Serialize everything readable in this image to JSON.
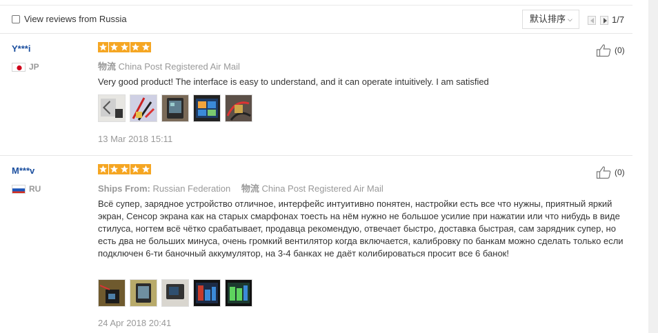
{
  "filter": {
    "checkbox_label": "View reviews from Russia",
    "sort_label": "默认排序",
    "page_indicator": "1/7"
  },
  "reviews": [
    {
      "user": "Y***i",
      "country": "JP",
      "flag": "japan-flag",
      "rating": 5,
      "ship_label": "物流",
      "ship_value": "China Post Registered Air Mail",
      "text": "Very good product! The interface is easy to understand, and it can operate intuitively. I am satisfied",
      "photo_count": 5,
      "date": "13 Mar 2018 15:11",
      "likes": "(0)"
    },
    {
      "user": "M***v",
      "country": "RU",
      "flag": "russia-flag",
      "rating": 5,
      "ships_from_label": "Ships From:",
      "ships_from_value": "Russian Federation",
      "ship_label": "物流",
      "ship_value": "China Post Registered Air Mail",
      "text": "Всё супер, зарядное устройство отличное, интерфейс интуитивно понятен, настройки есть все что нужны, приятный яркий экран, Сенсор экрана как на старых смарфонах тоесть на нём нужно не большое усилие при нажатии или что нибудь в виде стилуса, ногтем всё чётко срабатывает, продавца рекомендую, отвечает быстро, доставка быстрая, сам зарядник супер, но есть два не больших минуса, очень громкий вентилятор когда включается, калибровку по банкам можно сделать только если подключен 6-ти баночный аккумулятор, на 3-4 банках не даёт колибироваться просит все 6 банок!",
      "photo_count": 5,
      "date": "24 Apr 2018 20:41",
      "likes": "(0)"
    }
  ],
  "colors": {
    "star": "#f5a623",
    "username": "#1a4e9e",
    "muted": "#999999"
  }
}
